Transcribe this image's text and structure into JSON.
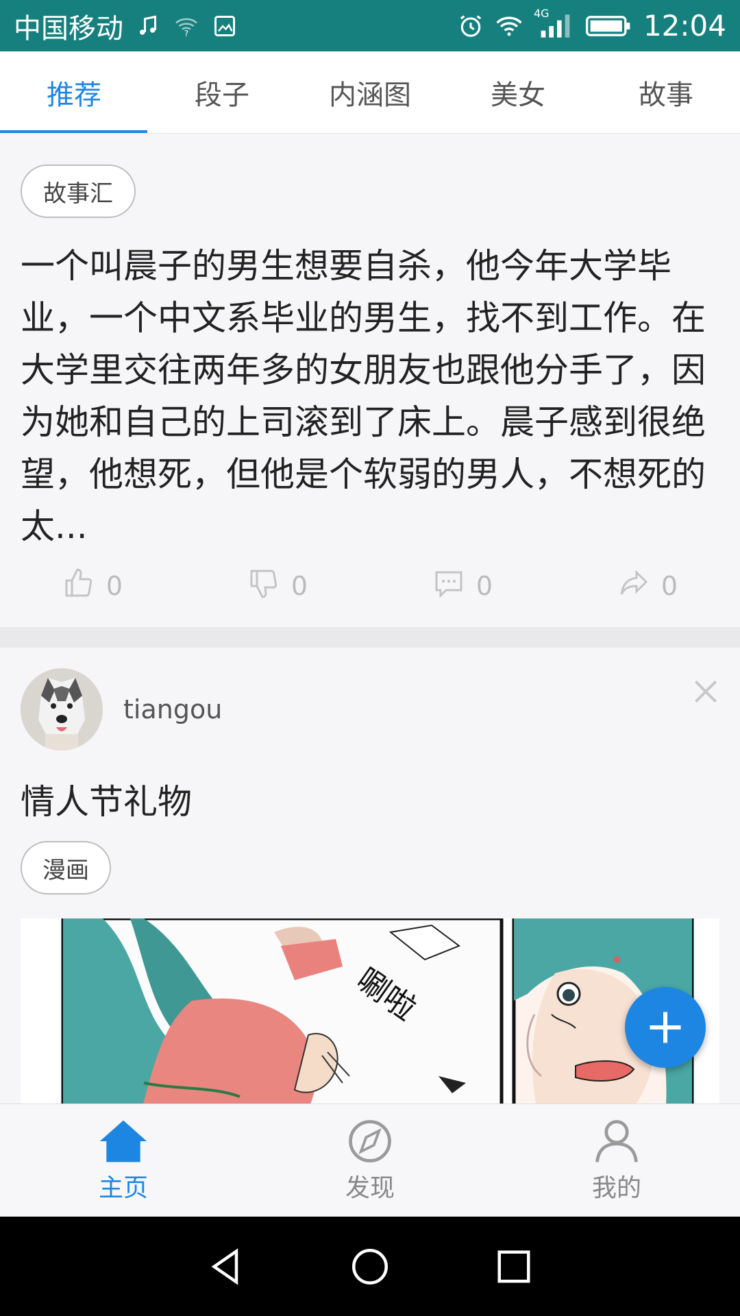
{
  "status_bar": {
    "carrier": "中国移动",
    "network": "4G",
    "time": "12:04"
  },
  "tabs": [
    {
      "label": "推荐",
      "active": true
    },
    {
      "label": "段子",
      "active": false
    },
    {
      "label": "内涵图",
      "active": false
    },
    {
      "label": "美女",
      "active": false
    },
    {
      "label": "故事",
      "active": false
    }
  ],
  "feed": {
    "post1": {
      "tag": "故事汇",
      "text": "一个叫晨子的男生想要自杀，他今年大学毕业，一个中文系毕业的男生，找不到工作。在大学里交往两年多的女朋友也跟他分手了，因为她和自己的上司滚到了床上。晨子感到很绝望，他想死，但他是个软弱的男人，不想死的太...",
      "likes": "0",
      "dislikes": "0",
      "comments": "0",
      "shares": "0"
    },
    "post2": {
      "username": "tiangou",
      "title": "情人节礼物",
      "tag": "漫画",
      "comic_sfx": "唰啦"
    }
  },
  "bottom_nav": [
    {
      "label": "主页",
      "icon": "home-icon",
      "active": true
    },
    {
      "label": "发现",
      "icon": "compass-icon",
      "active": false
    },
    {
      "label": "我的",
      "icon": "person-icon",
      "active": false
    }
  ],
  "colors": {
    "status_bar": "#16807e",
    "accent": "#1d86e2"
  }
}
